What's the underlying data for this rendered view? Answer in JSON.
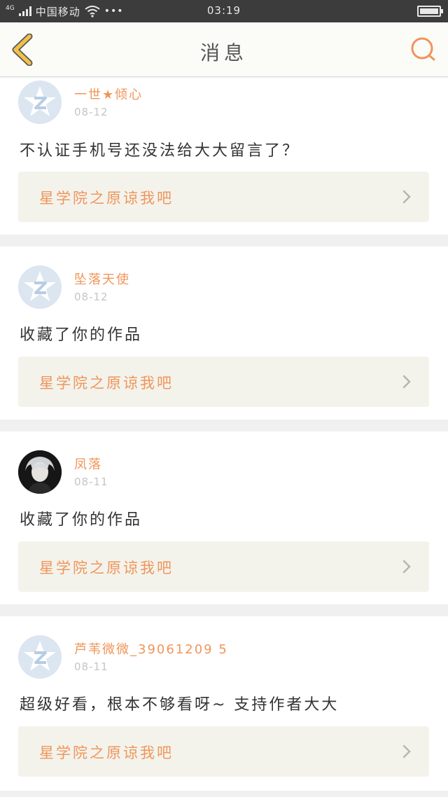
{
  "status_bar": {
    "network": "4G",
    "carrier": "中国移动",
    "extra": "•••",
    "time": "03:19"
  },
  "header": {
    "title": "消息"
  },
  "messages": [
    {
      "username": "一世★倾心",
      "date": "08-12",
      "text": "不认证手机号还没法给大大留言了？",
      "work_title": "星学院之原谅我吧",
      "avatar": "default-avatar-icon"
    },
    {
      "username": "坠落天使",
      "date": "08-12",
      "text": "收藏了你的作品",
      "work_title": "星学院之原谅我吧",
      "avatar": "default-avatar-icon"
    },
    {
      "username": "凤落",
      "date": "08-11",
      "text": "收藏了你的作品",
      "work_title": "星学院之原谅我吧",
      "avatar": "user-photo-avatar"
    },
    {
      "username": "芦苇微微_39061209 5",
      "date": "08-11",
      "text": "超级好看，根本不够看呀~ 支持作者大大",
      "work_title": "星学院之原谅我吧",
      "avatar": "default-avatar-icon"
    }
  ],
  "colors": {
    "accent": "#f0955a",
    "back_icon": "#f2c14a",
    "status_bar_bg": "#3c3c3c",
    "card_link_bg": "#f3f3ec"
  }
}
